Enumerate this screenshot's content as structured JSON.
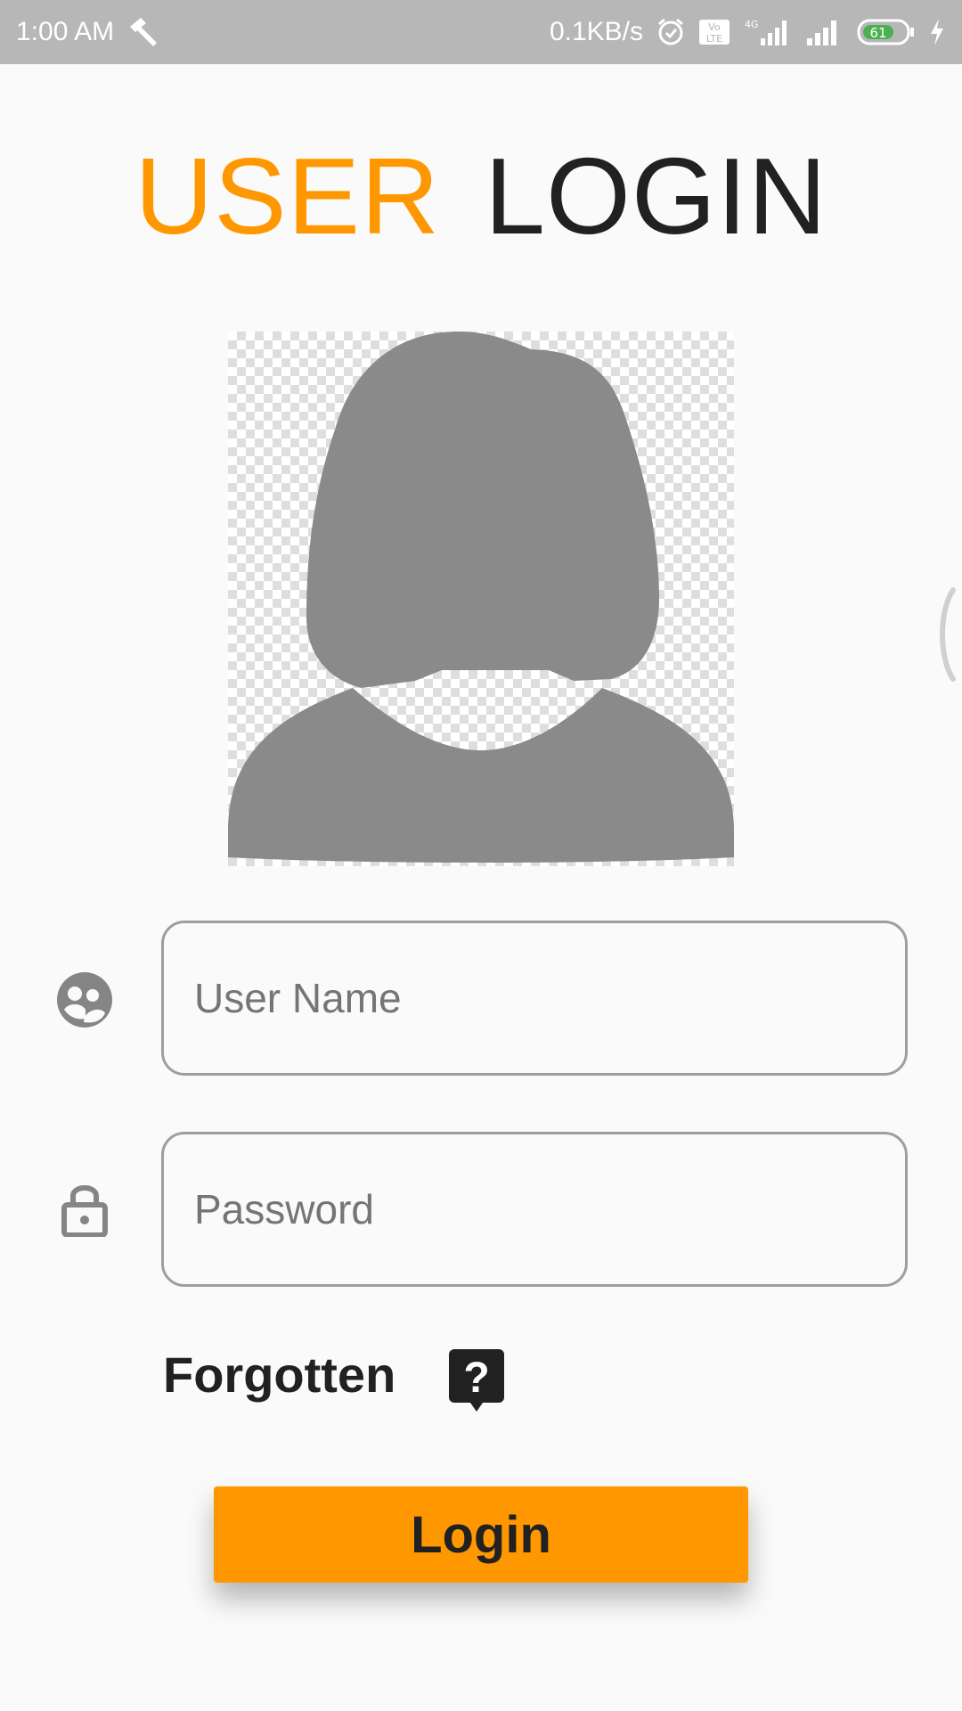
{
  "status_bar": {
    "time": "1:00 AM",
    "net_speed": "0.1KB/s",
    "battery": "61",
    "icons": [
      "broom-icon",
      "alarm-icon",
      "volte-icon",
      "signal-4g-icon",
      "signal-icon",
      "battery-icon",
      "charging-icon"
    ]
  },
  "header": {
    "title_part1": "USER",
    "title_part2": "LOGIN"
  },
  "form": {
    "username_placeholder": "User Name",
    "password_placeholder": "Password",
    "forgotten_label": "Forgotten",
    "login_label": "Login"
  },
  "colors": {
    "accent": "#ff9800",
    "status_bar": "#b7b7b7",
    "avatar": "#8a8a8a",
    "text_dark": "#212121"
  }
}
